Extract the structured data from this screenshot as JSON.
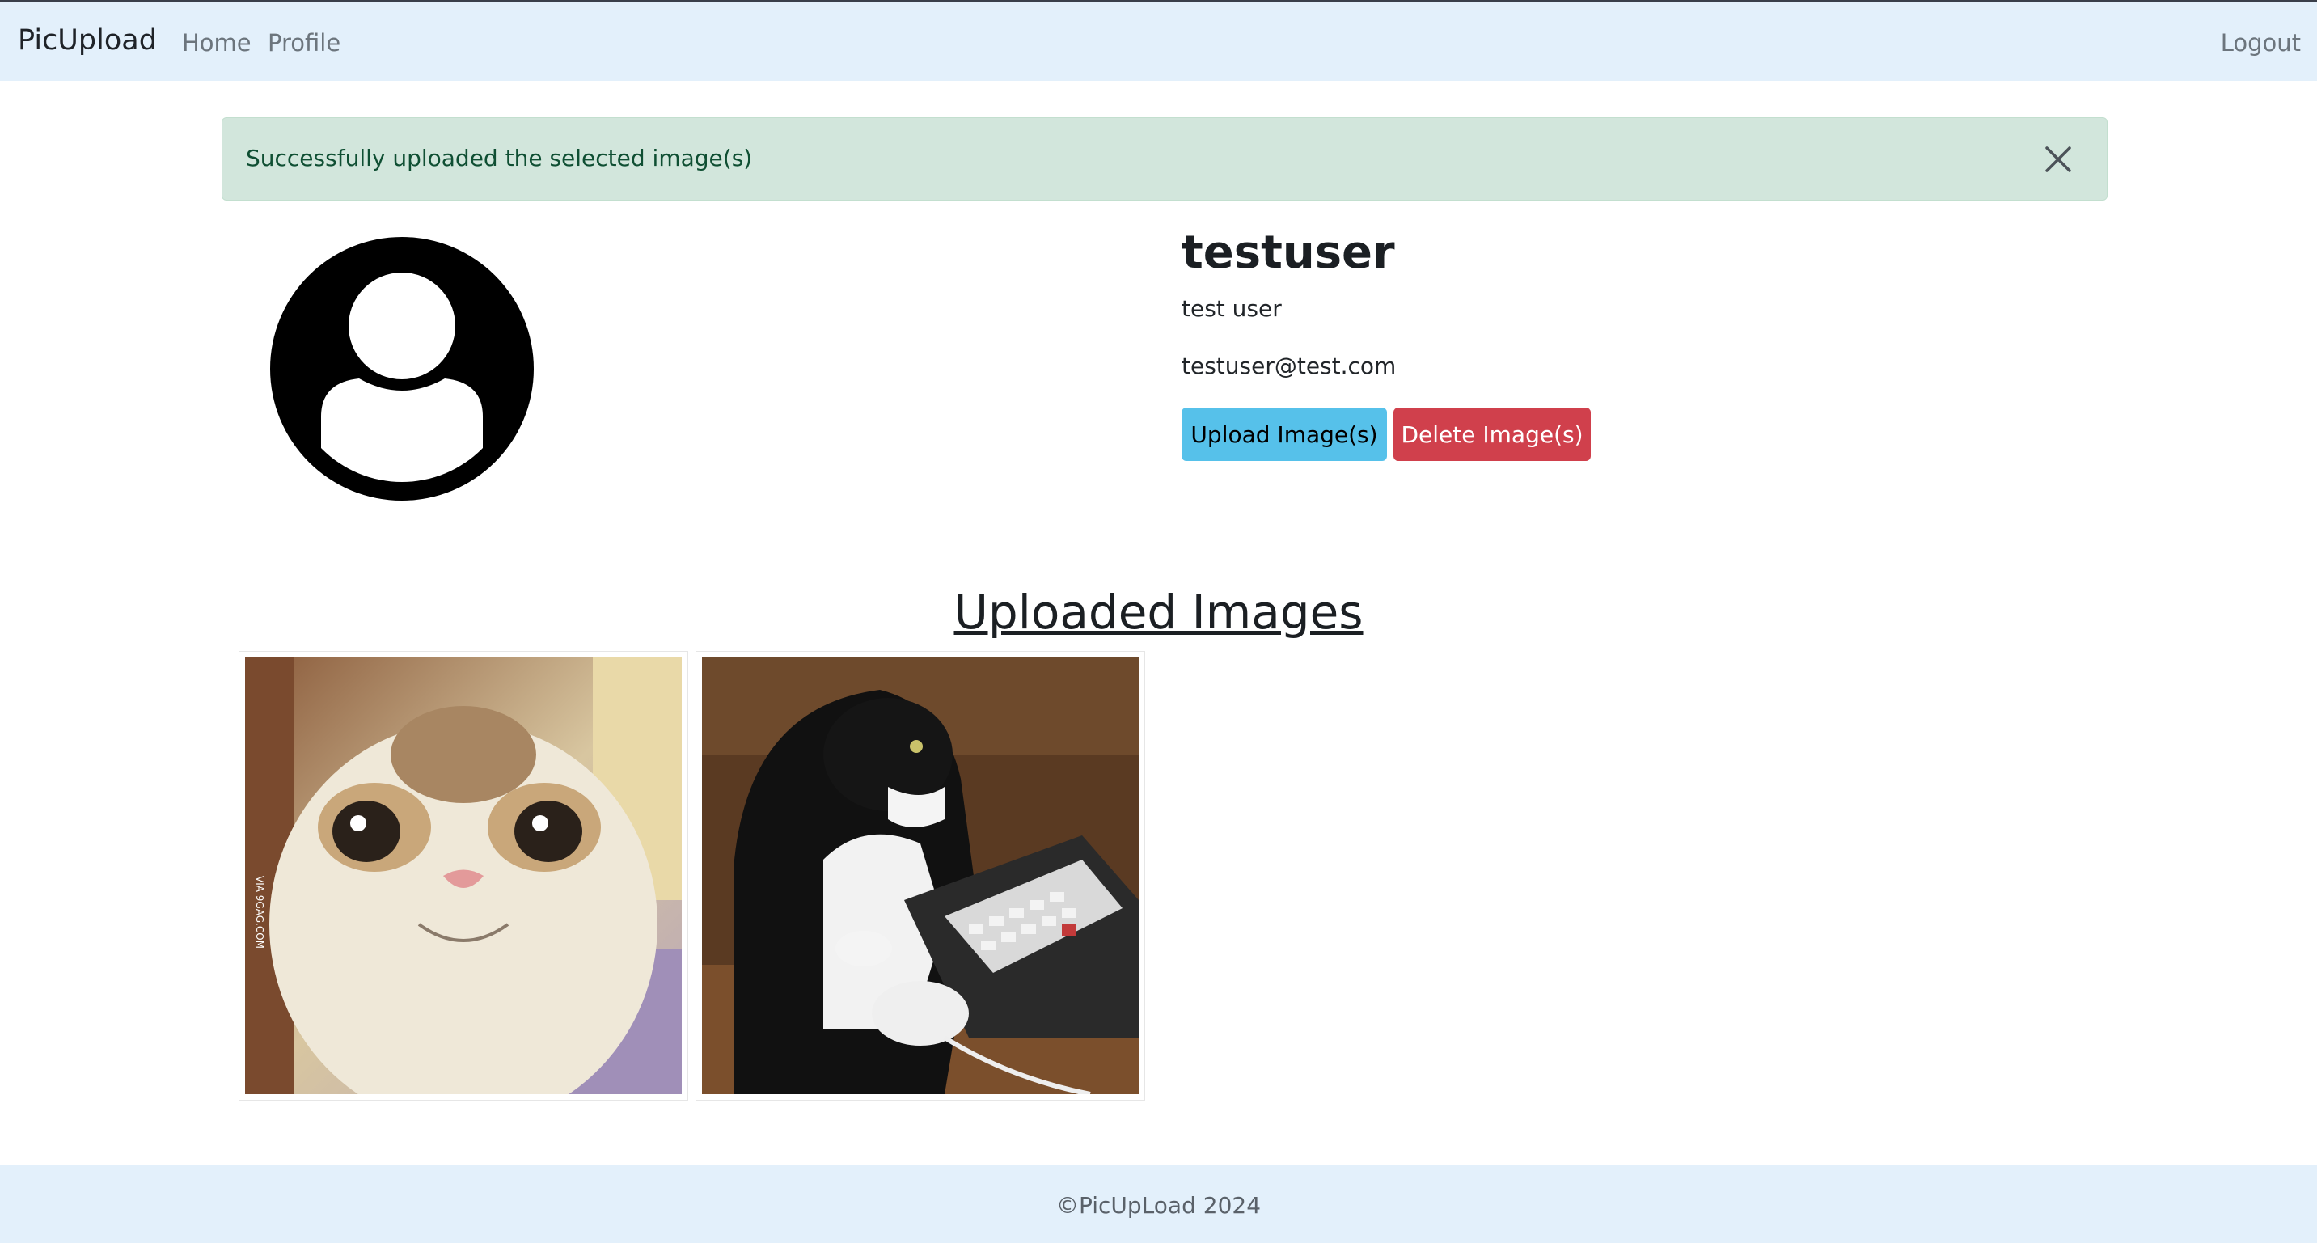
{
  "navbar": {
    "brand": "PicUpload",
    "links": [
      {
        "label": "Home"
      },
      {
        "label": "Profile"
      }
    ],
    "logout_label": "Logout"
  },
  "alert": {
    "message": "Successfully uploaded the selected image(s)",
    "close_icon": "close-icon"
  },
  "profile": {
    "avatar_icon": "user-avatar-icon",
    "username": "testuser",
    "full_name": "test user",
    "email": "testuser@test.com",
    "upload_label": "Upload Image(s)",
    "delete_label": "Delete Image(s)"
  },
  "gallery": {
    "title": "Uploaded Images",
    "images": [
      {
        "alt": "Smiling cat",
        "watermark": "VIA 9GAG.COM"
      },
      {
        "alt": "Cat at keyboard"
      }
    ]
  },
  "footer": {
    "text": "©PicUpLoad 2024"
  },
  "colors": {
    "navbar_bg": "#e3f0fb",
    "alert_bg": "#d2e6dc",
    "alert_text": "#0f4f33",
    "upload_btn": "#56c1ea",
    "delete_btn": "#d0404c"
  }
}
